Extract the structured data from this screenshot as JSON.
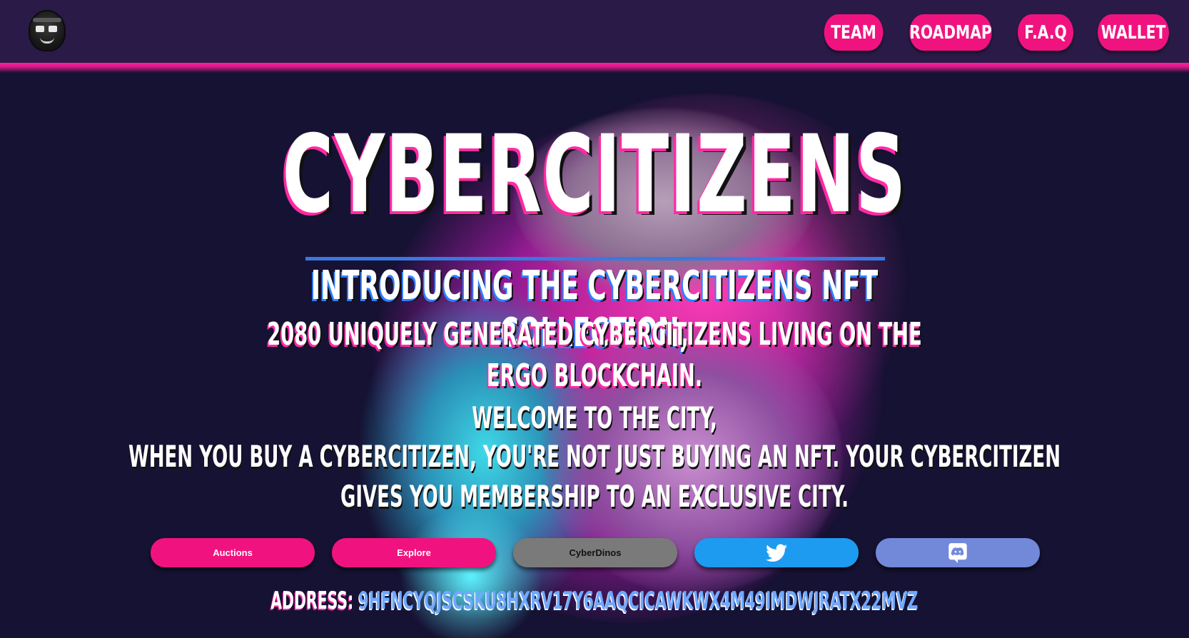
{
  "header": {
    "nav": [
      {
        "label": "TEAM"
      },
      {
        "label": "ROADMAP"
      },
      {
        "label": "F.A.Q"
      },
      {
        "label": "WALLET"
      }
    ]
  },
  "hero": {
    "title": "CYBERCITIZENS",
    "intro": "INTRODUCING THE CYBERCITIZENS NFT COLLECTION,",
    "line2": "2080 UNIQUELY GENERATED CYBERCITIZENS LIVING ON THE ERGO BLOCKCHAIN.",
    "welcome": "WELCOME TO THE CITY,",
    "body": "WHEN YOU BUY A CYBERCITIZEN, YOU'RE NOT JUST BUYING AN NFT. YOUR CYBERCITIZEN GIVES YOU MEMBERSHIP TO AN EXCLUSIVE CITY."
  },
  "buttons": {
    "auctions": "Auctions",
    "explore": "Explore",
    "cyberdinos": "CyberDinos",
    "twitter_icon": "twitter-icon",
    "discord_icon": "discord-icon"
  },
  "address": {
    "label": "ADDRESS:",
    "value": "9HFNCYQJSCSKU8HXRV17Y6AAQCICAWKWX4M49IMDWJRATX22MVZ"
  },
  "colors": {
    "background": "#161233",
    "header": "#2a1a47",
    "accent_pink": "#f0137f",
    "twitter_blue": "#1d9bf0",
    "discord_purple": "#7289da",
    "divider_blue": "#3a78e0"
  }
}
